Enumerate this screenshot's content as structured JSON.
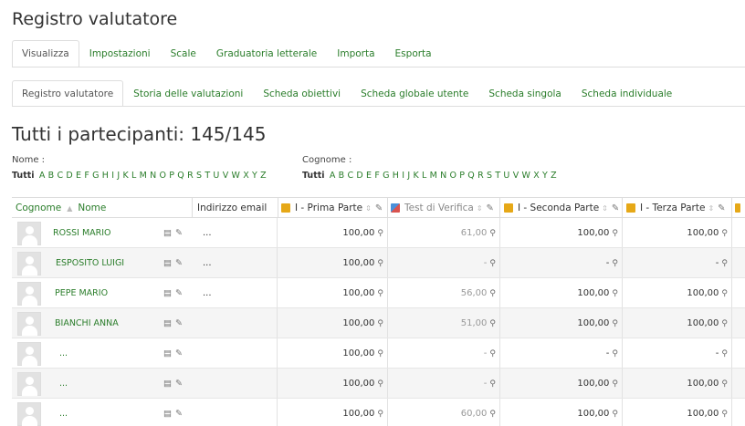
{
  "title": "Registro valutatore",
  "primary_tabs": [
    "Visualizza",
    "Impostazioni",
    "Scale",
    "Graduatoria letterale",
    "Importa",
    "Esporta"
  ],
  "secondary_tabs": [
    "Registro valutatore",
    "Storia delle valutazioni",
    "Scheda obiettivi",
    "Scheda globale utente",
    "Scheda singola",
    "Scheda individuale"
  ],
  "heading": "Tutti i partecipanti: 145/145",
  "filters": {
    "first_name_label": "Nome :",
    "last_name_label": "Cognome :",
    "all_label": "Tutti",
    "letters": [
      "A",
      "B",
      "C",
      "D",
      "E",
      "F",
      "G",
      "H",
      "I",
      "J",
      "K",
      "L",
      "M",
      "N",
      "O",
      "P",
      "Q",
      "R",
      "S",
      "T",
      "U",
      "V",
      "W",
      "X",
      "Y",
      "Z"
    ]
  },
  "columns": {
    "cognome": "Cognome",
    "nome": "Nome",
    "email": "Indirizzo email",
    "grades": [
      "I - Prima Parte",
      "Test di Verifica",
      "I - Seconda Parte",
      "I - Terza Parte"
    ],
    "sort_glyph": "▲",
    "sort_both_glyph": "⇕",
    "edit_glyph": "✎"
  },
  "rows": [
    {
      "name": "ROSSI MARIO",
      "email": "...",
      "grades": [
        "100,00",
        "61,00",
        "100,00",
        "100,00"
      ]
    },
    {
      "name": "ESPOSITO LUIGI",
      "email": "...",
      "grades": [
        "100,00",
        "-",
        "-",
        "-"
      ]
    },
    {
      "name": "PEPE MARIO",
      "email": "...",
      "grades": [
        "100,00",
        "56,00",
        "100,00",
        "100,00"
      ]
    },
    {
      "name": "BIANCHI ANNA",
      "email": "",
      "grades": [
        "100,00",
        "51,00",
        "100,00",
        "100,00"
      ]
    },
    {
      "name": "...",
      "email": "",
      "grades": [
        "100,00",
        "-",
        "-",
        "-"
      ]
    },
    {
      "name": "...",
      "email": "",
      "grades": [
        "100,00",
        "-",
        "100,00",
        "100,00"
      ]
    },
    {
      "name": "...",
      "email": "",
      "grades": [
        "100,00",
        "60,00",
        "100,00",
        "100,00"
      ]
    }
  ],
  "icons": {
    "report": "▤",
    "edit": "✎",
    "zoom": "⚲"
  },
  "colors": {
    "link": "#2a7d2a",
    "category": "#e6a817"
  }
}
